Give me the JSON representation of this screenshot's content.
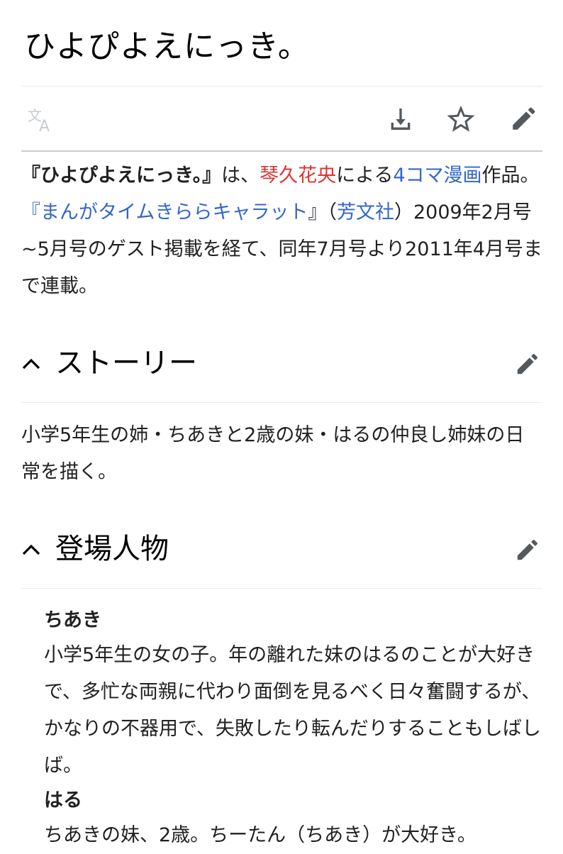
{
  "article": {
    "title": "ひよぴよえにっき。"
  },
  "toolbar": {
    "language_icon": "translate-icon",
    "download_icon": "download-icon",
    "watch_icon": "star-icon",
    "edit_icon": "pencil-icon"
  },
  "lead": {
    "bold_title": "『ひよぴよえにっき。』",
    "t1": "は、",
    "author_link": "琴久花央",
    "t2": "による",
    "genre_link": "4コマ漫画",
    "t3": "作品。",
    "magazine_link": "『まんがタイムきららキャラット",
    "t4": "』（",
    "publisher_link": "芳文社",
    "t5": "）2009年2月号~5月号のゲスト掲載を経て、同年7月号より2011年4月号まで連載。"
  },
  "sections": [
    {
      "title": "ストーリー",
      "collapse_icon": "chevron-up-icon",
      "edit_icon": "pencil-icon",
      "text": "小学5年生の姉・ちあきと2歳の妹・はるの仲良し姉妹の日常を描く。"
    },
    {
      "title": "登場人物",
      "collapse_icon": "chevron-up-icon",
      "edit_icon": "pencil-icon",
      "characters": [
        {
          "name": "ちあき",
          "description": "小学5年生の女の子。年の離れた妹のはるのことが大好きで、多忙な両親に代わり面倒を見るべく日々奮闘するが、かなりの不器用で、失敗したり転んだりすることもしばしば。"
        },
        {
          "name": "はる",
          "description": "ちあきの妹、2歳。ちーたん（ちあき）が大好き。"
        }
      ]
    }
  ],
  "colors": {
    "link": "#3366cc",
    "redlink": "#dd3333",
    "text": "#202122",
    "icon": "#54595d",
    "icon_disabled": "#c8ccd1",
    "divider": "#eaecf0"
  }
}
